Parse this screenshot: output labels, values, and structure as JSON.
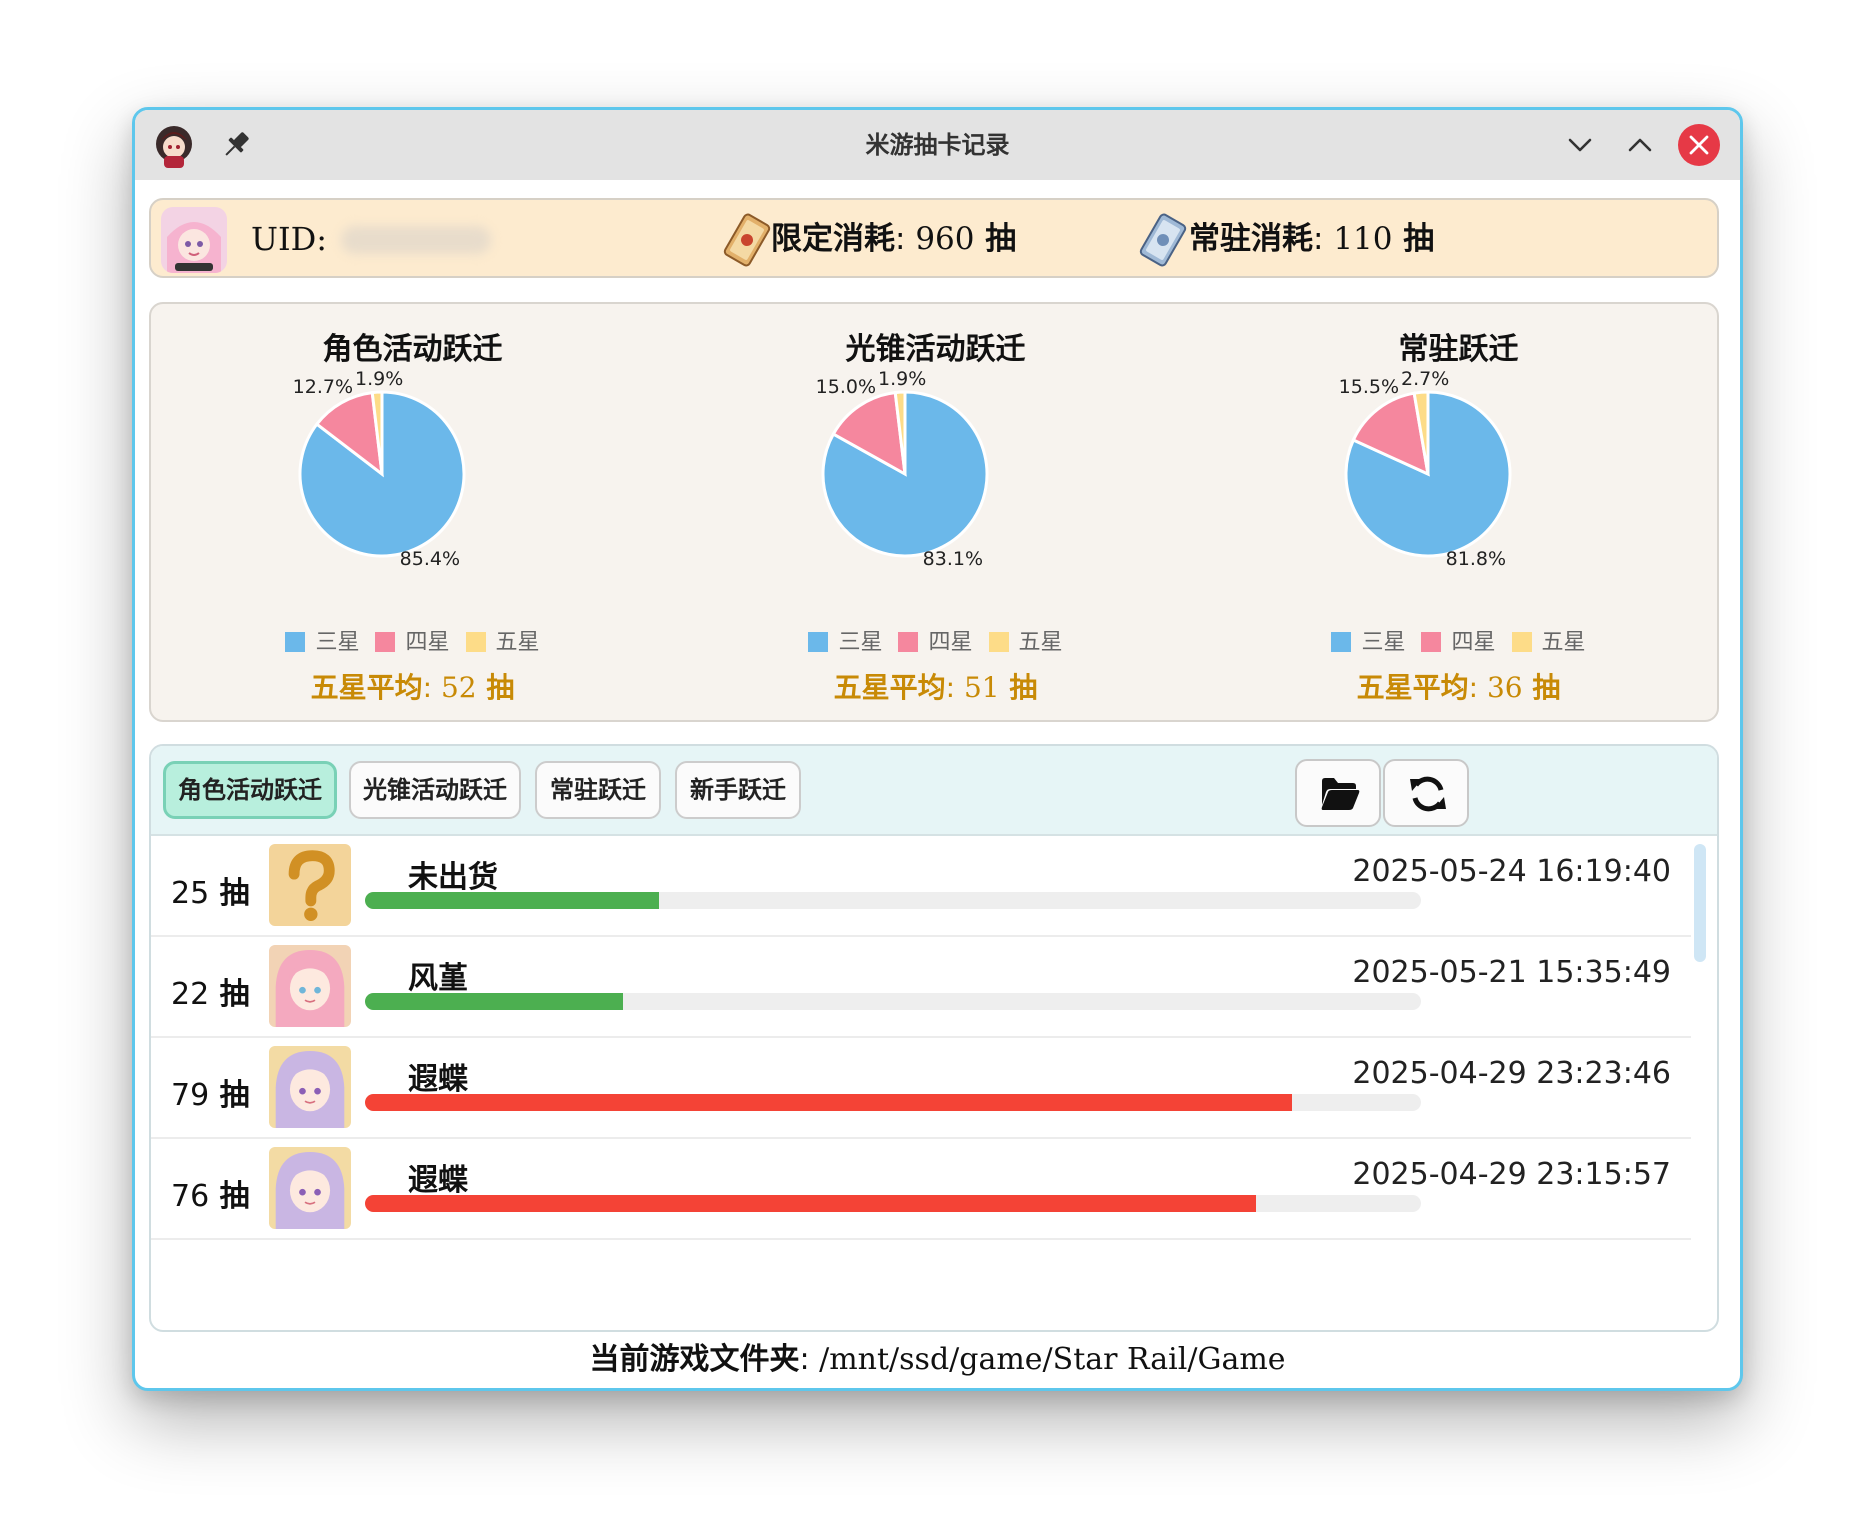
{
  "window": {
    "title": "米游抽卡记录"
  },
  "info": {
    "uid_label": "UID:",
    "limited": {
      "label": "限定消耗",
      "sep": ": ",
      "value": "960",
      "unit": " 抽"
    },
    "standard": {
      "label": "常驻消耗",
      "sep": ": ",
      "value": "110",
      "unit": " 抽"
    }
  },
  "legend_labels": [
    "三星",
    "四星",
    "五星"
  ],
  "colors": {
    "three_star": "#6bb8ea",
    "four_star": "#f5879e",
    "five_star": "#fddc88",
    "bar_green": "#4caf50",
    "bar_red": "#f44336",
    "avg_gold": "#c88a06",
    "accent_border": "#5ec7ec"
  },
  "chart_data": [
    {
      "type": "pie",
      "title": "角色活动跃迁",
      "categories": [
        "三星",
        "四星",
        "五星"
      ],
      "values": [
        85.4,
        12.7,
        1.9
      ],
      "labels": [
        "85.4%",
        "12.7%",
        "1.9%"
      ],
      "legend": "bottom",
      "avg": {
        "label": "五星平均",
        "sep": ": ",
        "value": "52",
        "unit": " 抽"
      }
    },
    {
      "type": "pie",
      "title": "光锥活动跃迁",
      "categories": [
        "三星",
        "四星",
        "五星"
      ],
      "values": [
        83.1,
        15.0,
        1.9
      ],
      "labels": [
        "83.1%",
        "15.0%",
        "1.9%"
      ],
      "legend": "bottom",
      "avg": {
        "label": "五星平均",
        "sep": ": ",
        "value": "51",
        "unit": " 抽"
      }
    },
    {
      "type": "pie",
      "title": "常驻跃迁",
      "categories": [
        "三星",
        "四星",
        "五星"
      ],
      "values": [
        81.8,
        15.5,
        2.7
      ],
      "labels": [
        "81.8%",
        "15.5%",
        "2.7%"
      ],
      "legend": "bottom",
      "avg": {
        "label": "五星平均",
        "sep": ": ",
        "value": "36",
        "unit": " 抽"
      }
    }
  ],
  "tabs": [
    {
      "label": "角色活动跃迁",
      "active": true
    },
    {
      "label": "光锥活动跃迁",
      "active": false
    },
    {
      "label": "常驻跃迁",
      "active": false
    },
    {
      "label": "新手跃迁",
      "active": false
    }
  ],
  "toolbar": {
    "open_folder_icon": "folder-open-icon",
    "refresh_icon": "refresh-icon"
  },
  "records": [
    {
      "count": "25",
      "unit": " 抽",
      "name": "未出货",
      "time": "2025-05-24 16:19:40",
      "progress": 0.278,
      "status": "green",
      "icon": "question-mark-icon"
    },
    {
      "count": "22",
      "unit": " 抽",
      "name": "风堇",
      "time": "2025-05-21 15:35:49",
      "progress": 0.244,
      "status": "green",
      "icon": "character-portrait-icon"
    },
    {
      "count": "79",
      "unit": " 抽",
      "name": "遐蝶",
      "time": "2025-04-29 23:23:46",
      "progress": 0.878,
      "status": "red",
      "icon": "character-portrait-icon"
    },
    {
      "count": "76",
      "unit": " 抽",
      "name": "遐蝶",
      "time": "2025-04-29 23:15:57",
      "progress": 0.844,
      "status": "red",
      "icon": "character-portrait-icon"
    }
  ],
  "footer": {
    "label": "当前游戏文件夹",
    "sep": ": ",
    "path": "/mnt/ssd/game/Star Rail/Game"
  }
}
